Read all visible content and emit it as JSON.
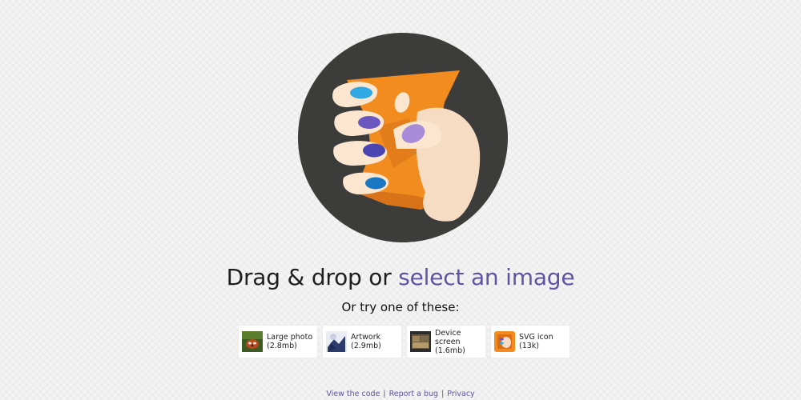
{
  "colors": {
    "accent": "#5f53a4",
    "logo_circle": "#3c3c3b",
    "logo_orange": "#f28c1e"
  },
  "hero": {
    "logo_icon": "hand-holding-squoosh-logo-icon",
    "prompt_prefix": "Drag & drop or ",
    "select_link": "select an image",
    "try_text": "Or try one of these:"
  },
  "samples": [
    {
      "label": "Large photo",
      "size": "(2.8mb)",
      "icon": "red-panda-thumbnail"
    },
    {
      "label": "Artwork",
      "size": "(2.9mb)",
      "icon": "artwork-thumbnail"
    },
    {
      "label": "Device screen",
      "size": "(1.6mb)",
      "icon": "device-screen-thumbnail"
    },
    {
      "label": "SVG icon",
      "size": "(13k)",
      "icon": "svg-icon-thumbnail"
    }
  ],
  "footer": {
    "links": [
      "View the code",
      "Report a bug",
      "Privacy"
    ],
    "separator": "|"
  }
}
